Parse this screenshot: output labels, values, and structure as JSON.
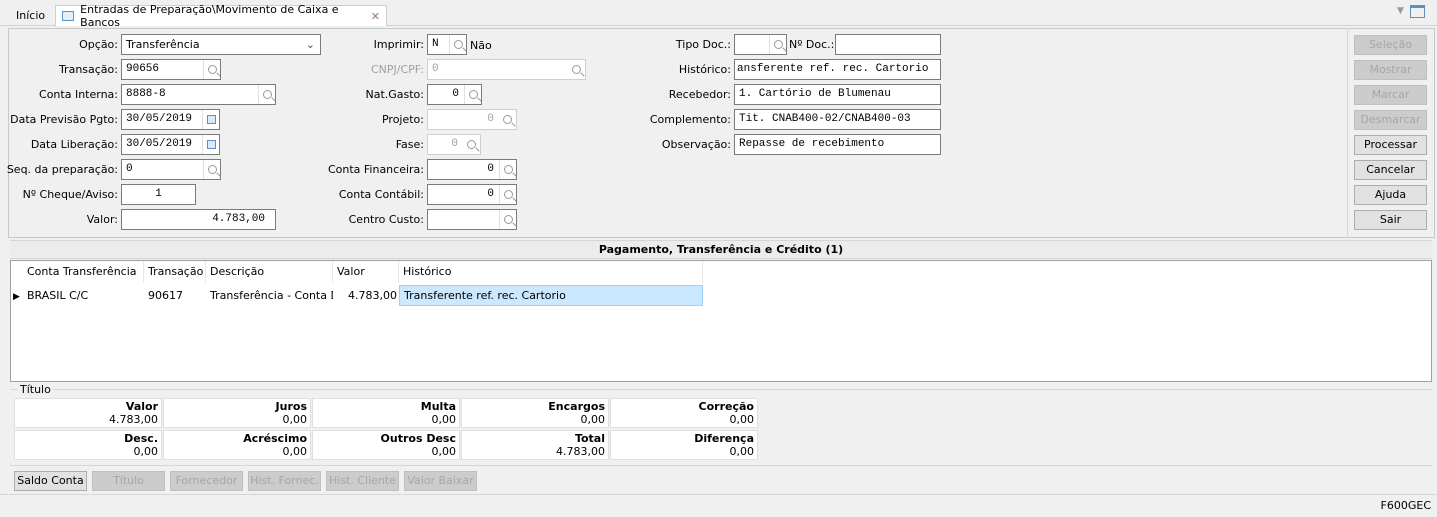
{
  "tabs": {
    "home": "Início",
    "active": "Entradas de Preparação\\Movimento de Caixa e Bancos"
  },
  "form": {
    "opcao": {
      "label": "Opção:",
      "value": "Transferência"
    },
    "transacao": {
      "label": "Transação:",
      "value": "90656"
    },
    "conta_interna": {
      "label": "Conta Interna:",
      "value": "8888-8"
    },
    "data_previsao": {
      "label": "Data Previsão Pgto:",
      "value": "30/05/2019"
    },
    "data_liberacao": {
      "label": "Data Liberação:",
      "value": "30/05/2019"
    },
    "seq": {
      "label": "Seq. da preparação:",
      "value": "0"
    },
    "cheque": {
      "label": "Nº Cheque/Aviso:",
      "value": "1"
    },
    "valor": {
      "label": "Valor:",
      "value": "4.783,00"
    },
    "imprimir": {
      "label": "Imprimir:",
      "value": "N",
      "desc": "Não"
    },
    "cnpj": {
      "label": "CNPJ/CPF:",
      "value": "0"
    },
    "nat_gasto": {
      "label": "Nat.Gasto:",
      "value": "0"
    },
    "projeto": {
      "label": "Projeto:",
      "value": "0"
    },
    "fase": {
      "label": "Fase:",
      "value": "0"
    },
    "conta_financeira": {
      "label": "Conta Financeira:",
      "value": "0"
    },
    "conta_contabil": {
      "label": "Conta Contábil:",
      "value": "0"
    },
    "centro_custo": {
      "label": "Centro Custo:",
      "value": ""
    },
    "tipo_doc": {
      "label": "Tipo Doc.:",
      "value": ""
    },
    "num_doc": {
      "label": "Nº Doc.:",
      "value": ""
    },
    "historico": {
      "label": "Histórico:",
      "value": "ansferente ref. rec. Cartorio"
    },
    "recebedor": {
      "label": "Recebedor:",
      "value": "1. Cartório de Blumenau"
    },
    "complemento": {
      "label": "Complemento:",
      "value": "Tit. CNAB400-02/CNAB400-03"
    },
    "observacao": {
      "label": "Observação:",
      "value": "Repasse de recebimento"
    }
  },
  "side_buttons": [
    "Seleção",
    "Mostrar",
    "Marcar",
    "Desmarcar",
    "Processar",
    "Cancelar",
    "Ajuda",
    "Sair"
  ],
  "grid": {
    "title": "Pagamento, Transferência e Crédito (1)",
    "columns": [
      "Conta Transferência",
      "Transação",
      "Descrição",
      "Valor",
      "Histórico"
    ],
    "rows": [
      [
        "BRASIL C/C",
        "90617",
        "Transferência - Conta De",
        "4.783,00",
        "Transferente ref. rec. Cartorio"
      ]
    ]
  },
  "titulo": {
    "label": "Título",
    "cells": [
      {
        "label": "Valor",
        "value": "4.783,00"
      },
      {
        "label": "Juros",
        "value": "0,00"
      },
      {
        "label": "Multa",
        "value": "0,00"
      },
      {
        "label": "Encargos",
        "value": "0,00"
      },
      {
        "label": "Correção",
        "value": "0,00"
      },
      {
        "label": "Desc.",
        "value": "0,00"
      },
      {
        "label": "Acréscimo",
        "value": "0,00"
      },
      {
        "label": "Outros Desc",
        "value": "0,00"
      },
      {
        "label": "Total",
        "value": "4.783,00"
      },
      {
        "label": "Diferença",
        "value": "0,00"
      }
    ]
  },
  "bottom_buttons": [
    "Saldo Conta",
    "Título",
    "Fornecedor",
    "Hist. Fornec.",
    "Hist. Cliente",
    "Valor Baixar"
  ],
  "status": {
    "code": "F600GEC"
  }
}
